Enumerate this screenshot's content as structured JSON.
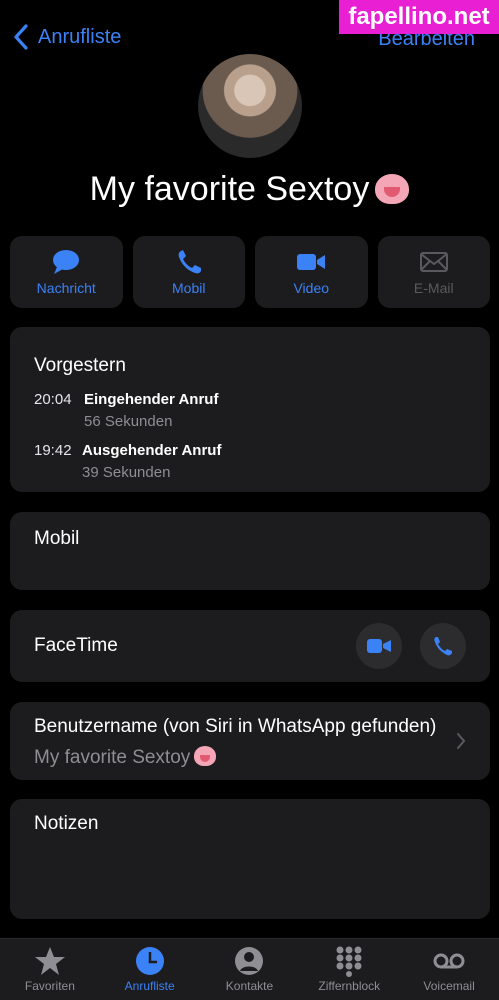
{
  "nav": {
    "back_label": "Anrufliste",
    "edit_label": "Bearbeiten"
  },
  "watermark": "fapellino.net",
  "contact": {
    "name": "My favorite Sextoy",
    "name_emoji": "tongue-emoji"
  },
  "actions": [
    {
      "label": "Nachricht",
      "icon": "message-icon",
      "enabled": true
    },
    {
      "label": "Mobil",
      "icon": "phone-icon",
      "enabled": true
    },
    {
      "label": "Video",
      "icon": "video-icon",
      "enabled": true
    },
    {
      "label": "E-Mail",
      "icon": "mail-icon",
      "enabled": false
    }
  ],
  "recents": {
    "day": "Vorgestern",
    "calls": [
      {
        "time": "20:04",
        "type": "Eingehender Anruf",
        "duration": "56 Sekunden"
      },
      {
        "time": "19:42",
        "type": "Ausgehender Anruf",
        "duration": "39 Sekunden"
      }
    ]
  },
  "mobil": {
    "label": "Mobil"
  },
  "facetime": {
    "label": "FaceTime"
  },
  "username": {
    "label": "Benutzername (von Siri in WhatsApp gefunden)",
    "value": "My favorite Sextoy"
  },
  "notes": {
    "label": "Notizen"
  },
  "tabs": [
    {
      "label": "Favoriten",
      "icon": "star-icon",
      "active": false
    },
    {
      "label": "Anrufliste",
      "icon": "clock-icon",
      "active": true
    },
    {
      "label": "Kontakte",
      "icon": "person-icon",
      "active": false
    },
    {
      "label": "Ziffernblock",
      "icon": "keypad-icon",
      "active": false
    },
    {
      "label": "Voicemail",
      "icon": "voicemail-icon",
      "active": false
    }
  ],
  "colors": {
    "accent": "#3b82f6",
    "card": "#1c1c1e",
    "background": "#000000",
    "watermark": "#e81fd2"
  }
}
